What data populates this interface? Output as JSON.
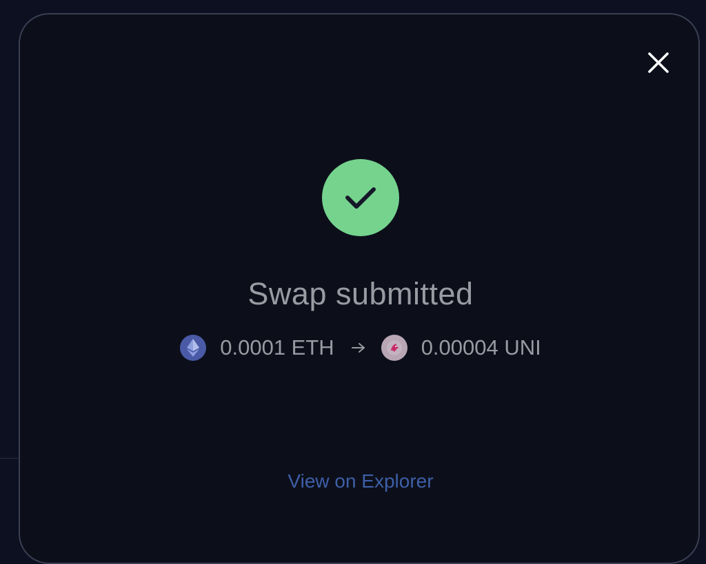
{
  "modal": {
    "title": "Swap submitted",
    "close_icon": "close-icon",
    "status_icon": "check-circle-icon",
    "status_color": "#75d38e",
    "swap": {
      "from_amount": "0.0001 ETH",
      "from_icon": "eth-token-icon",
      "arrow_icon": "arrow-right-icon",
      "to_amount": "0.00004 UNI",
      "to_icon": "uni-token-icon"
    },
    "explorer_link": "View on Explorer",
    "link_color": "#3e5fa8"
  }
}
